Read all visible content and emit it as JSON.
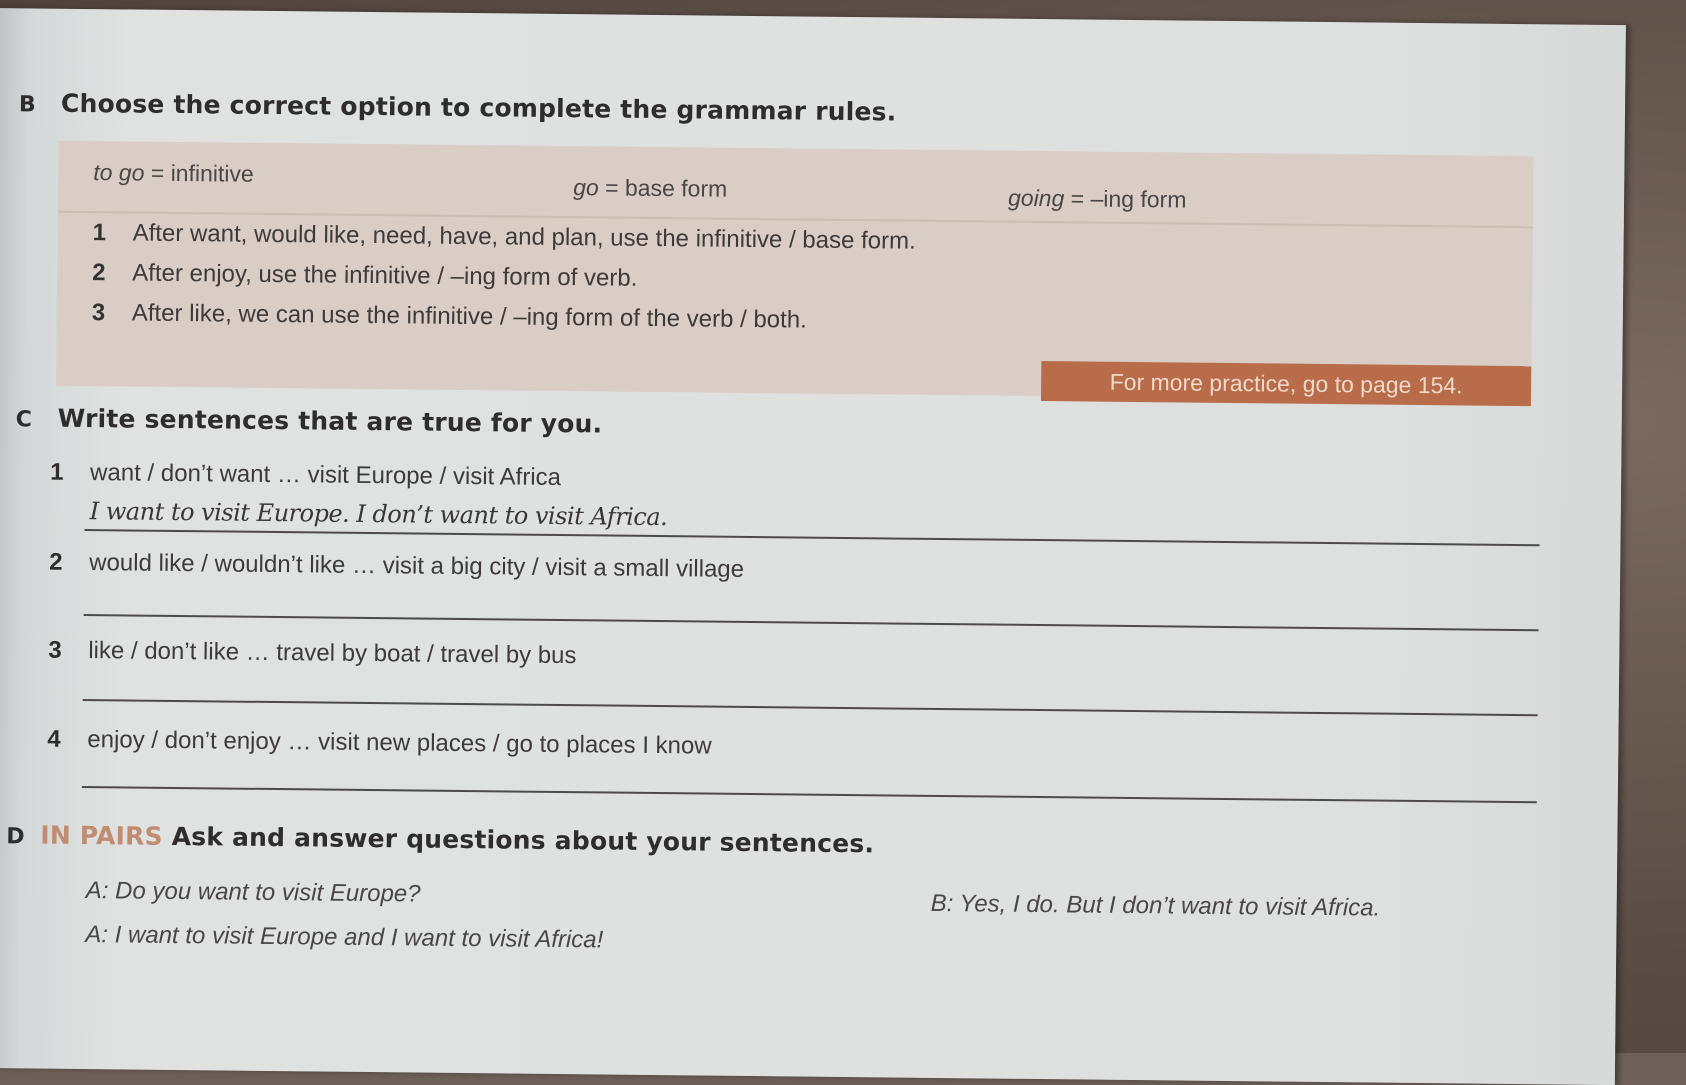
{
  "section_b": {
    "letter": "B",
    "instruction": "Choose the correct option to complete the grammar rules.",
    "definitions": [
      {
        "term": "to go",
        "sep": " = ",
        "meaning": "infinitive"
      },
      {
        "term": "go",
        "sep": " = ",
        "meaning": "base form"
      },
      {
        "term": "going",
        "sep": " = ",
        "meaning": "–ing form"
      }
    ],
    "rules": [
      {
        "num": "1",
        "text": "After want, would like, need, have, and plan, use the infinitive  /  base form."
      },
      {
        "num": "2",
        "text": "After enjoy, use the infinitive  /  –ing form of verb."
      },
      {
        "num": "3",
        "text": "After like, we can use the infinitive / –ing form of the verb  /  both."
      }
    ],
    "practice_link": "For more practice, go to page 154."
  },
  "section_c": {
    "letter": "C",
    "instruction": "Write sentences that are true for you.",
    "items": [
      {
        "num": "1",
        "prompt": "want / don’t want … visit Europe / visit Africa",
        "answer": "I want to visit Europe. I don’t want to visit Africa."
      },
      {
        "num": "2",
        "prompt": "would like / wouldn’t like … visit a big city / visit a small village",
        "answer": ""
      },
      {
        "num": "3",
        "prompt": "like / don’t like … travel by boat / travel by bus",
        "answer": ""
      },
      {
        "num": "4",
        "prompt": "enjoy / don’t enjoy … visit new places / go to places I know",
        "answer": ""
      }
    ]
  },
  "section_d": {
    "letter": "D",
    "tag": "IN PAIRS",
    "instruction": "Ask and answer questions about your sentences.",
    "dialogue": [
      {
        "line": "A: Do you want to visit Europe?"
      },
      {
        "line": "B: Yes, I do. But I don’t want to visit Africa."
      },
      {
        "line": "A: I want to visit Europe and I want to visit Africa!"
      }
    ]
  },
  "colors": {
    "grammar_box": "#d9cdc5",
    "practice_tag": "#b96c49",
    "in_pairs_accent": "#c08d73",
    "page": "#dfe2e1"
  }
}
